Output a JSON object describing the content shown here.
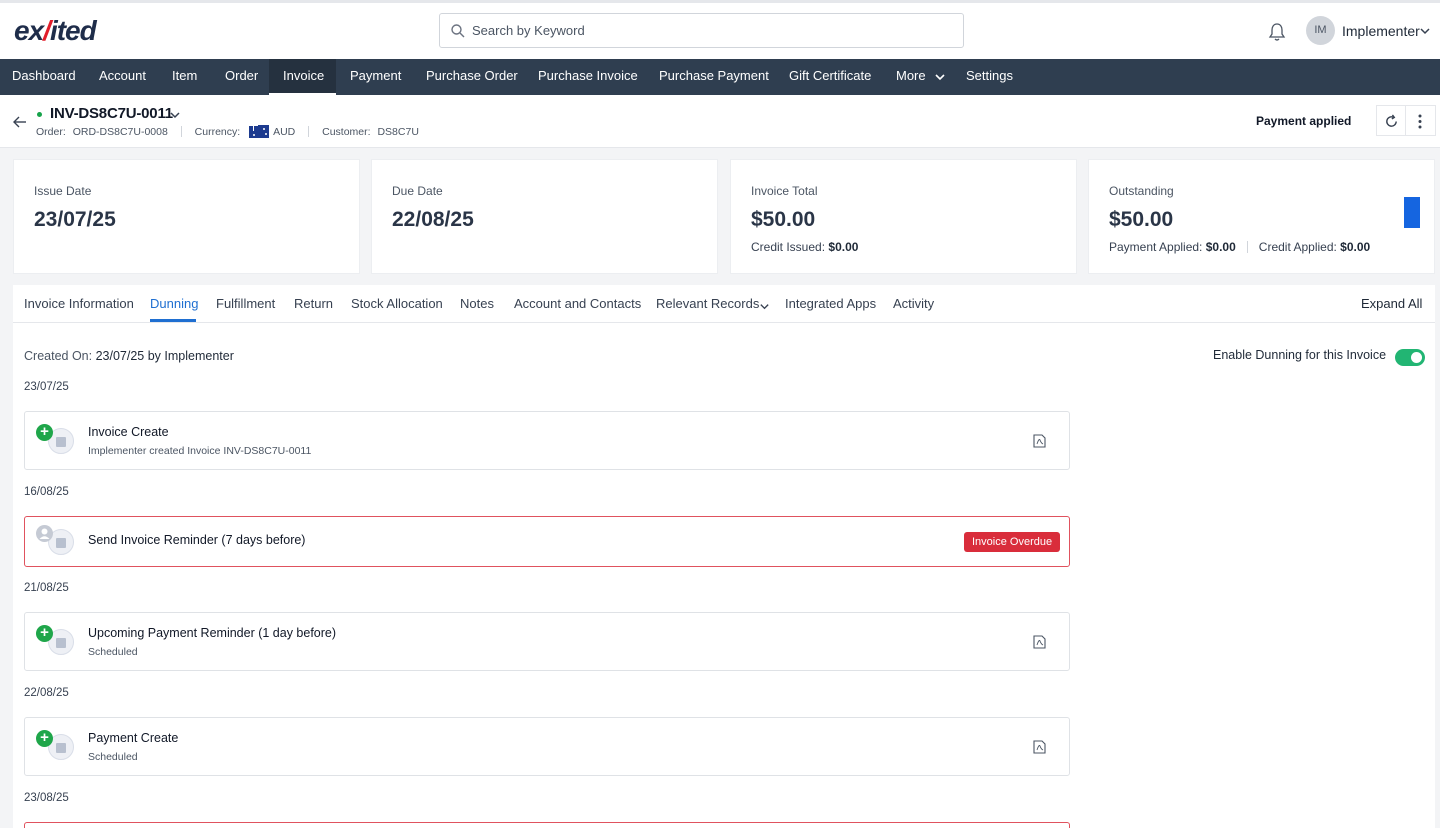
{
  "app": {
    "logo_text_1": "ex",
    "logo_text_2": "/",
    "logo_text_3": "ited",
    "search_placeholder": "Search by Keyword",
    "user_initials": "IM",
    "user_name": "Implementer"
  },
  "nav": {
    "items": [
      "Dashboard",
      "Account",
      "Item",
      "Order",
      "Invoice",
      "Payment",
      "Purchase Order",
      "Purchase Invoice",
      "Purchase Payment",
      "Gift Certificate",
      "More",
      "Settings"
    ],
    "active": "Invoice"
  },
  "header": {
    "invoice_number": "INV-DS8C7U-0011",
    "order_label": "Order:",
    "order_value": "ORD-DS8C7U-0008",
    "currency_label": "Currency:",
    "currency_value": "AUD",
    "customer_label": "Customer:",
    "customer_value": "DS8C7U",
    "status": "Payment applied",
    "status_dot_color": "#16a34a"
  },
  "cards": {
    "issue": {
      "label": "Issue Date",
      "value": "23/07/25"
    },
    "due": {
      "label": "Due Date",
      "value": "22/08/25"
    },
    "total": {
      "label": "Invoice Total",
      "value": "$50.00",
      "credit_label": "Credit Issued:",
      "credit_value": "$0.00"
    },
    "outstanding": {
      "label": "Outstanding",
      "value": "$50.00",
      "payment_label": "Payment Applied:",
      "payment_value": "$0.00",
      "credit_label": "Credit Applied:",
      "credit_value": "$0.00"
    }
  },
  "tabs": {
    "items": [
      "Invoice Information",
      "Dunning",
      "Fulfillment",
      "Return",
      "Stock Allocation",
      "Notes",
      "Account and Contacts",
      "Relevant Records",
      "Integrated Apps",
      "Activity"
    ],
    "active": "Dunning",
    "expand_all": "Expand All"
  },
  "dunning": {
    "created_label": "Created On:",
    "created_value": "23/07/25 by Implementer",
    "enable_label": "Enable Dunning for this Invoice",
    "enabled": true,
    "accent_color": "#22b573",
    "dates": [
      "23/07/25",
      "16/08/25",
      "21/08/25",
      "22/08/25",
      "23/08/25"
    ],
    "events": [
      {
        "title": "Invoice Create",
        "desc": "Implementer created Invoice INV-DS8C7U-0011",
        "icon": "plus-icon"
      },
      {
        "title": "Send Invoice Reminder (7 days before)",
        "badge": "Invoice Overdue",
        "badge_color": "#d92d3b",
        "icon": "person-icon"
      },
      {
        "title": "Upcoming Payment Reminder (1 day before)",
        "desc": "Scheduled",
        "icon": "plus-icon"
      },
      {
        "title": "Payment Create",
        "desc": "Scheduled",
        "icon": "plus-icon"
      }
    ]
  }
}
